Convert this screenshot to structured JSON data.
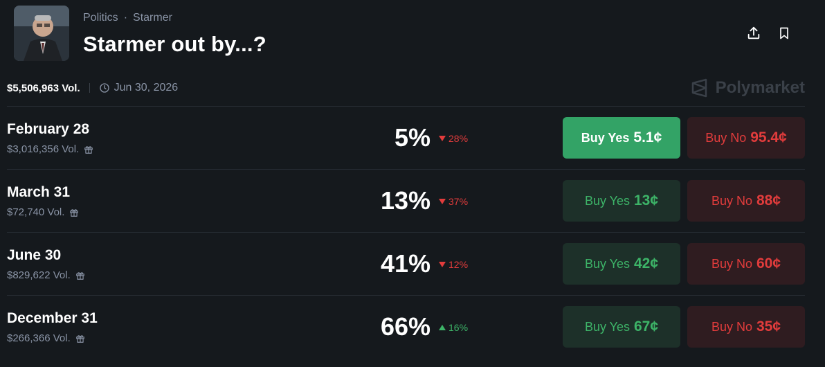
{
  "header": {
    "breadcrumb": [
      "Politics",
      "Starmer"
    ],
    "title": "Starmer out by...?",
    "actions": [
      "share-icon",
      "bookmark-icon"
    ]
  },
  "meta": {
    "volume": "$5,506,963 Vol.",
    "end_date": "Jun 30, 2026",
    "brand": "Polymarket"
  },
  "colors": {
    "background": "#15191d",
    "yes_green": "#3db468",
    "no_red": "#e23c3c",
    "yes_active_bg": "#33a366"
  },
  "rows": [
    {
      "name": "February 28",
      "volume": "$3,016,356 Vol.",
      "percent": "5%",
      "change": "28%",
      "direction": "down",
      "yes_label": "Buy Yes",
      "yes_price": "5.1¢",
      "no_label": "Buy No",
      "no_price": "95.4¢",
      "yes_active": true
    },
    {
      "name": "March 31",
      "volume": "$72,740 Vol.",
      "percent": "13%",
      "change": "37%",
      "direction": "down",
      "yes_label": "Buy Yes",
      "yes_price": "13¢",
      "no_label": "Buy No",
      "no_price": "88¢",
      "yes_active": false
    },
    {
      "name": "June 30",
      "volume": "$829,622 Vol.",
      "percent": "41%",
      "change": "12%",
      "direction": "down",
      "yes_label": "Buy Yes",
      "yes_price": "42¢",
      "no_label": "Buy No",
      "no_price": "60¢",
      "yes_active": false
    },
    {
      "name": "December 31",
      "volume": "$266,366 Vol.",
      "percent": "66%",
      "change": "16%",
      "direction": "up",
      "yes_label": "Buy Yes",
      "yes_price": "67¢",
      "no_label": "Buy No",
      "no_price": "35¢",
      "yes_active": false
    }
  ]
}
